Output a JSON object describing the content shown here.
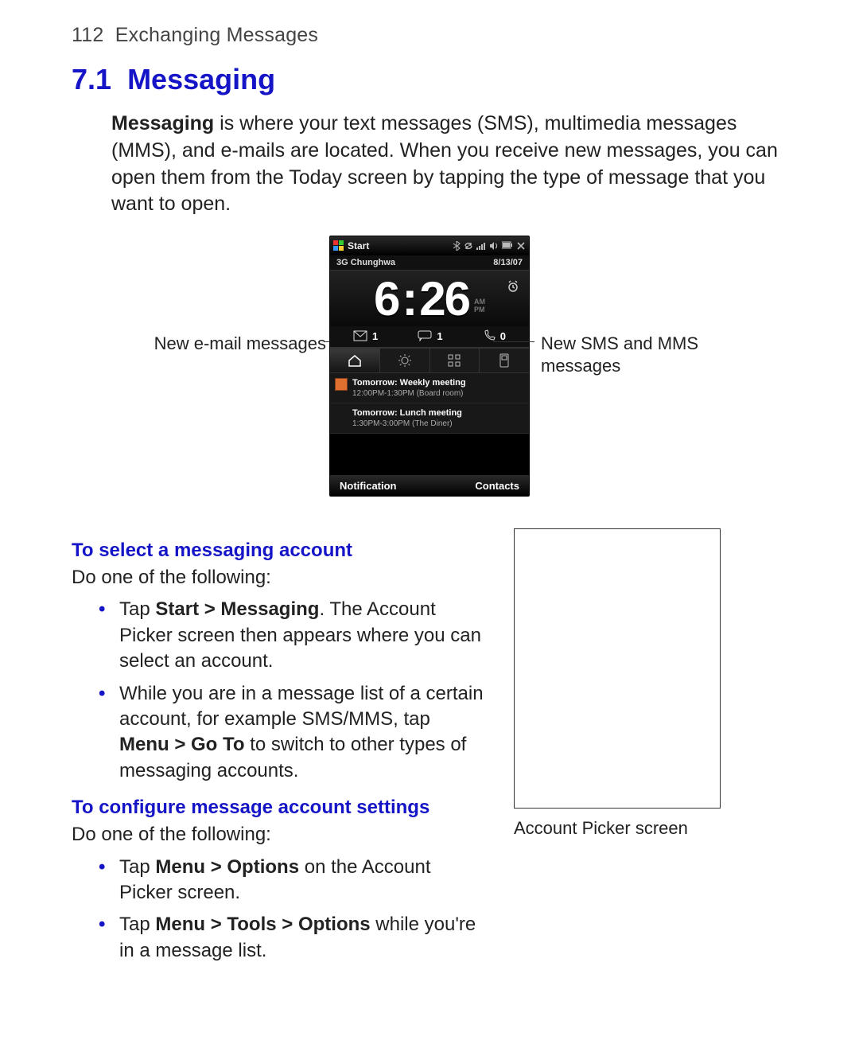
{
  "header": {
    "page_number": "112",
    "chapter": "Exchanging Messages"
  },
  "section": {
    "number": "7.1",
    "title": "Messaging"
  },
  "intro": {
    "lead_bold": "Messaging",
    "rest": " is where your text messages (SMS), multimedia messages (MMS), and e-mails are located. When you receive new messages, you can open them from the Today screen by tapping the type of message that you want to open."
  },
  "device": {
    "titlebar_text": "Start",
    "carrier": "3G Chunghwa",
    "date": "8/13/07",
    "clock_hh": "6",
    "clock_mm": "26",
    "am_label": "AM",
    "pm_label": "PM",
    "counters": {
      "mail": "1",
      "sms": "1",
      "calls": "0"
    },
    "events": [
      {
        "title": "Tomorrow: Weekly meeting",
        "sub": "12:00PM-1:30PM (Board room)"
      },
      {
        "title": "Tomorrow: Lunch meeting",
        "sub": "1:30PM-3:00PM (The Diner)"
      }
    ],
    "softkey_left": "Notification",
    "softkey_right": "Contacts"
  },
  "callouts": {
    "left": "New e-mail messages",
    "right": "New SMS and MMS messages"
  },
  "body": {
    "select_heading": "To select a messaging account",
    "select_lead": "Do one of the following:",
    "select_items": [
      {
        "pre": "Tap ",
        "bold": "Start > Messaging",
        "post": ". The Account Picker screen then appears where you can select an account."
      },
      {
        "pre": "While you are in a message list of a certain account, for example SMS/MMS, tap ",
        "bold": "Menu > Go To",
        "post": " to switch to other types of messaging accounts."
      }
    ],
    "config_heading": "To configure message account settings",
    "config_lead": "Do one of the following:",
    "config_items": [
      {
        "pre": "Tap ",
        "bold": "Menu > Options",
        "post": " on the Account Picker screen."
      },
      {
        "pre": "Tap ",
        "bold": "Menu > Tools > Options",
        "post": " while you're in a message list."
      }
    ],
    "figure_caption": "Account Picker screen"
  }
}
